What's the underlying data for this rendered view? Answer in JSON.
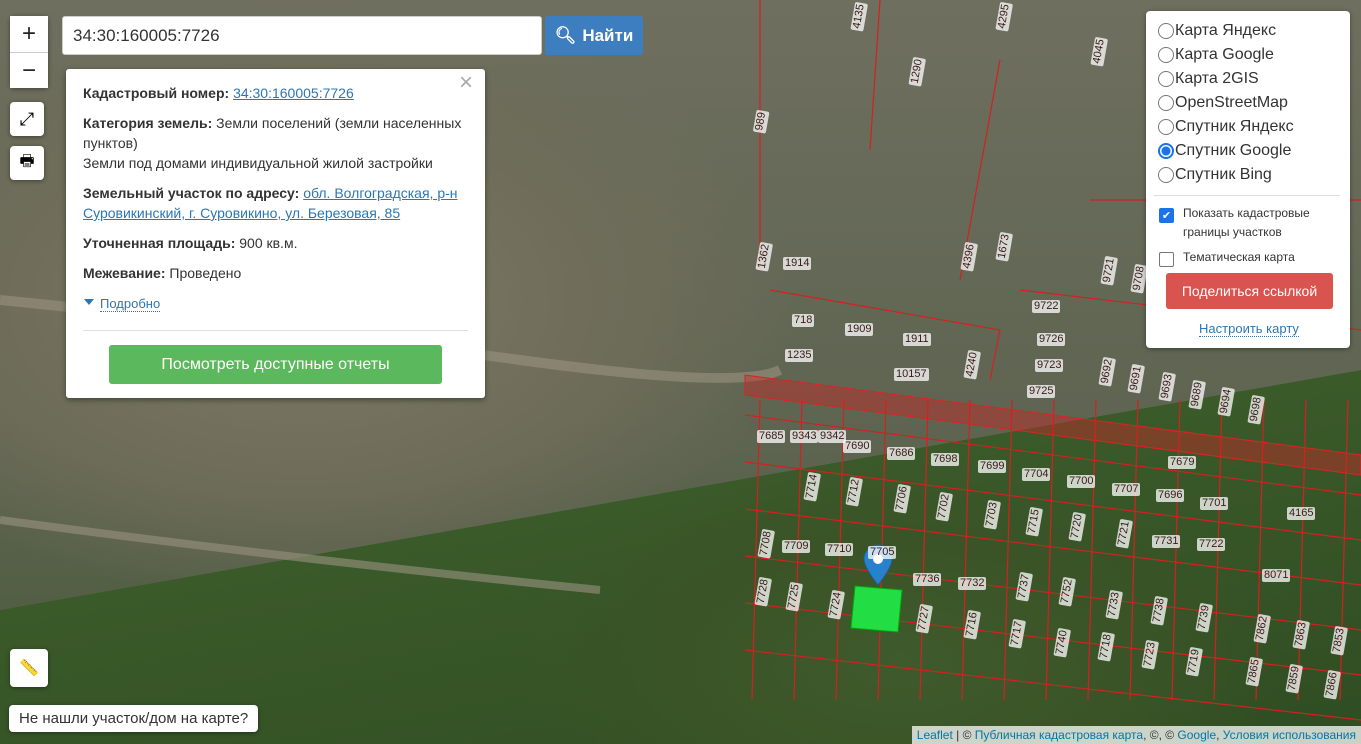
{
  "search": {
    "value": "34:30:160005:7726",
    "button": "Найти",
    "icon": "search-icon"
  },
  "zoom": {
    "in": "+",
    "out": "−"
  },
  "popup": {
    "cad_label": "Кадастровый номер:",
    "cad_value": "34:30:160005:7726",
    "cat_label": "Категория земель:",
    "cat_value": "Земли поселений (земли населенных пунктов)",
    "use_value": "Земли под домами индивидуальной жилой застройки",
    "addr_label": "Земельный участок по адресу:",
    "addr_value": "обл. Волгоградская, р-н Суровикинский, г. Суровикино, ул. Березовая, 85",
    "area_label": "Уточненная площадь:",
    "area_value": "900 кв.м.",
    "survey_label": "Межевание:",
    "survey_value": "Проведено",
    "more": "Подробно",
    "reports": "Посмотреть доступные отчеты",
    "close": "×"
  },
  "layers": {
    "options": [
      "Карта Яндекс",
      "Карта Google",
      "Карта 2GIS",
      "OpenStreetMap",
      "Спутник Яндекс",
      "Спутник Google",
      "Спутник Bing"
    ],
    "selected": "Спутник Google",
    "show_borders": "Показать кадастровые границы участков",
    "show_borders_checked": true,
    "thematic": "Тематическая карта",
    "thematic_checked": false,
    "share": "Поделиться ссылкой",
    "configure": "Настроить карту"
  },
  "notfound": "Не нашли участок/дом на карте?",
  "attribution": {
    "leaflet": "Leaflet",
    "sep": " | © ",
    "pkk": "Публичная кадастровая карта",
    "mid": ", ©, © ",
    "google": "Google",
    "comma": ", ",
    "terms": "Условия использования"
  },
  "parcels": [
    "7685",
    "9343",
    "9342",
    "7690",
    "7686",
    "7698",
    "7699",
    "7704",
    "7700",
    "7707",
    "7696",
    "7701",
    "7714",
    "7712",
    "7706",
    "7702",
    "7703",
    "7715",
    "7720",
    "7721",
    "7731",
    "7722",
    "7708",
    "7709",
    "7710",
    "7705",
    "7736",
    "7732",
    "7737",
    "7752",
    "7733",
    "7738",
    "7739",
    "7728",
    "7725",
    "7724",
    "7727",
    "7716",
    "7717",
    "7740",
    "7718",
    "7723",
    "7719",
    "7679",
    "718",
    "1909",
    "1911",
    "1235",
    "10157",
    "4240",
    "9722",
    "9726",
    "9723",
    "9725",
    "9692",
    "9691",
    "9693",
    "9689",
    "9694",
    "9698",
    "1362",
    "1914",
    "4396",
    "1673",
    "9721",
    "9708",
    "989",
    "1290",
    "4135",
    "4295",
    "4045",
    "8071",
    "4165",
    "7862",
    "7863",
    "7853",
    "7865",
    "7859",
    "7866"
  ],
  "selected_parcel_color": "#22dd44"
}
